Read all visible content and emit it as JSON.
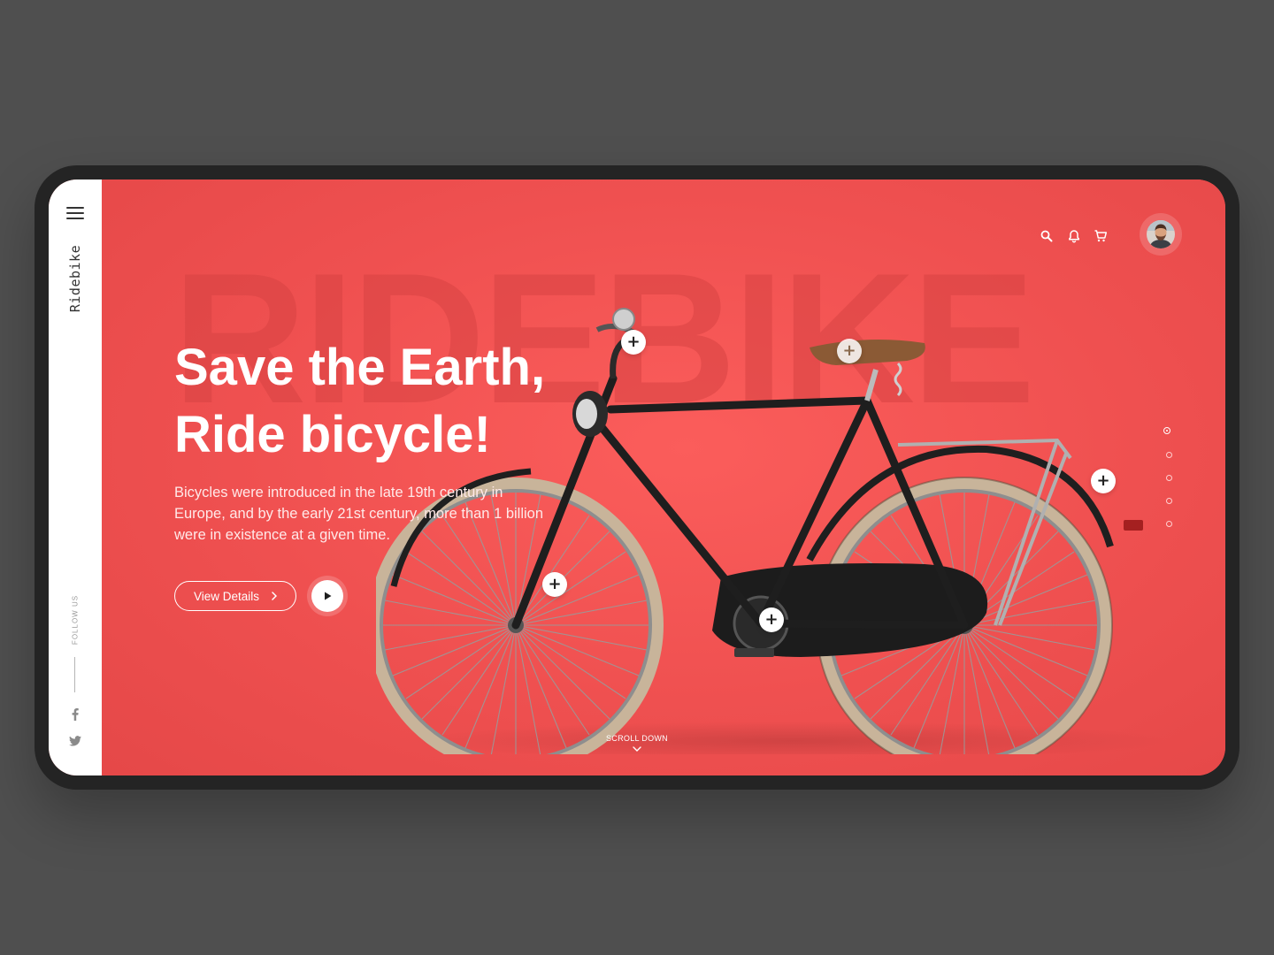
{
  "app": {
    "brand": "Ridebike",
    "watermark": "RIDEBIKE"
  },
  "sidebar": {
    "menu_icon": "hamburger-menu-icon",
    "follow_label": "FOLLOW US",
    "social": [
      {
        "name": "facebook",
        "icon": "facebook-icon"
      },
      {
        "name": "twitter",
        "icon": "twitter-icon"
      }
    ]
  },
  "header": {
    "icons": [
      "search-icon",
      "bell-icon",
      "cart-icon"
    ],
    "avatar": "user-avatar"
  },
  "hero": {
    "headline_line1": "Save the Earth,",
    "headline_line2": "Ride bicycle!",
    "description": "Bicycles were introduced in the late 19th century in Europe, and by the early 21st century, more than 1 billion were in existence at a given time.",
    "view_details_label": "View Details",
    "play_icon": "play-icon",
    "scroll_down_label": "SCROLL DOWN",
    "hotspot_symbol": "+"
  },
  "slider": {
    "total": 5,
    "active": 1
  },
  "colors": {
    "accent": "#ee5050",
    "sidebar": "#ffffff",
    "device": "#242424",
    "background": "#4f4f4f"
  }
}
